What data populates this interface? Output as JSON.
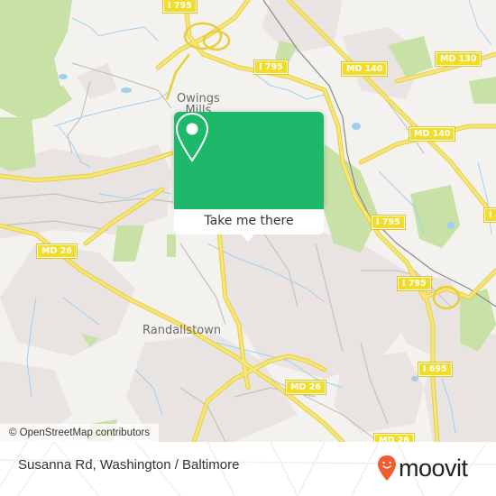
{
  "map": {
    "places": [
      {
        "id": "owings-mills",
        "label": "Owings\nMills"
      },
      {
        "id": "randallstown",
        "label": "Randallstown"
      }
    ],
    "shields": [
      {
        "id": "i795-top",
        "label": "I 795"
      },
      {
        "id": "i795-mid",
        "label": "I 795"
      },
      {
        "id": "md140-top",
        "label": "MD 140"
      },
      {
        "id": "md130",
        "label": "MD 130"
      },
      {
        "id": "md140-right",
        "label": "MD 140"
      },
      {
        "id": "i795-east",
        "label": "I 795"
      },
      {
        "id": "i795-southeast",
        "label": "I 795"
      },
      {
        "id": "i-edge",
        "label": "I"
      },
      {
        "id": "md26-west",
        "label": "MD 26"
      },
      {
        "id": "md26-south",
        "label": "MD 26"
      },
      {
        "id": "i695",
        "label": "I 695"
      },
      {
        "id": "md26-bottom",
        "label": "MD 26"
      }
    ],
    "attribution": "© OpenStreetMap contributors",
    "colors": {
      "background": "#f3f2ef",
      "residential": "#e9e4e2",
      "park": "#c8e1a6",
      "water": "#9fd0ef",
      "highway": "#f3de5c",
      "road": "#c8c2be"
    }
  },
  "popup": {
    "button_label": "Take me there",
    "accent": "#1db86a"
  },
  "footer": {
    "title": "Susanna Rd, Washington / Baltimore",
    "brand": "moovit",
    "brand_color": "#f25d2f"
  }
}
